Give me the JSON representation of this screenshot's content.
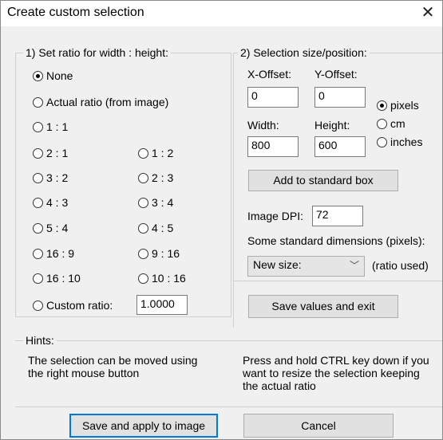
{
  "window": {
    "title": "Create custom selection"
  },
  "ratio_group": {
    "legend": "1) Set ratio for width : height:",
    "options": [
      {
        "label": "None",
        "selected": true
      },
      {
        "label": "Actual ratio (from image)",
        "selected": false
      },
      {
        "label": "1 : 1",
        "selected": false
      },
      {
        "label": "2 : 1",
        "selected": false
      },
      {
        "label": "1 : 2",
        "selected": false
      },
      {
        "label": "3 : 2",
        "selected": false
      },
      {
        "label": "2 : 3",
        "selected": false
      },
      {
        "label": "4 : 3",
        "selected": false
      },
      {
        "label": "3 : 4",
        "selected": false
      },
      {
        "label": "5 : 4",
        "selected": false
      },
      {
        "label": "4 : 5",
        "selected": false
      },
      {
        "label": "16 : 9",
        "selected": false
      },
      {
        "label": "9 : 16",
        "selected": false
      },
      {
        "label": "16 : 10",
        "selected": false
      },
      {
        "label": "10 : 16",
        "selected": false
      }
    ],
    "custom": {
      "label": "Custom ratio:",
      "value": "1.0000"
    }
  },
  "size_group": {
    "legend": "2) Selection size/position:",
    "x_offset": {
      "label": "X-Offset:",
      "value": "0"
    },
    "y_offset": {
      "label": "Y-Offset:",
      "value": "0"
    },
    "width": {
      "label": "Width:",
      "value": "800"
    },
    "height": {
      "label": "Height:",
      "value": "600"
    },
    "units": [
      {
        "label": "pixels",
        "selected": true
      },
      {
        "label": "cm",
        "selected": false
      },
      {
        "label": "inches",
        "selected": false
      }
    ],
    "add_button": "Add to standard box",
    "dpi": {
      "label": "Image DPI:",
      "value": "72"
    },
    "standard_label": "Some standard dimensions (pixels):",
    "standard_select": "New size:",
    "ratio_used": "(ratio used)",
    "save_exit_button": "Save values and exit"
  },
  "hints": {
    "legend": "Hints:",
    "left": "The selection can be moved using the right mouse button",
    "right": "Press and hold CTRL key down if you want to resize the selection keeping the actual ratio"
  },
  "footer": {
    "apply_button": "Save and apply to image",
    "cancel_button": "Cancel"
  }
}
